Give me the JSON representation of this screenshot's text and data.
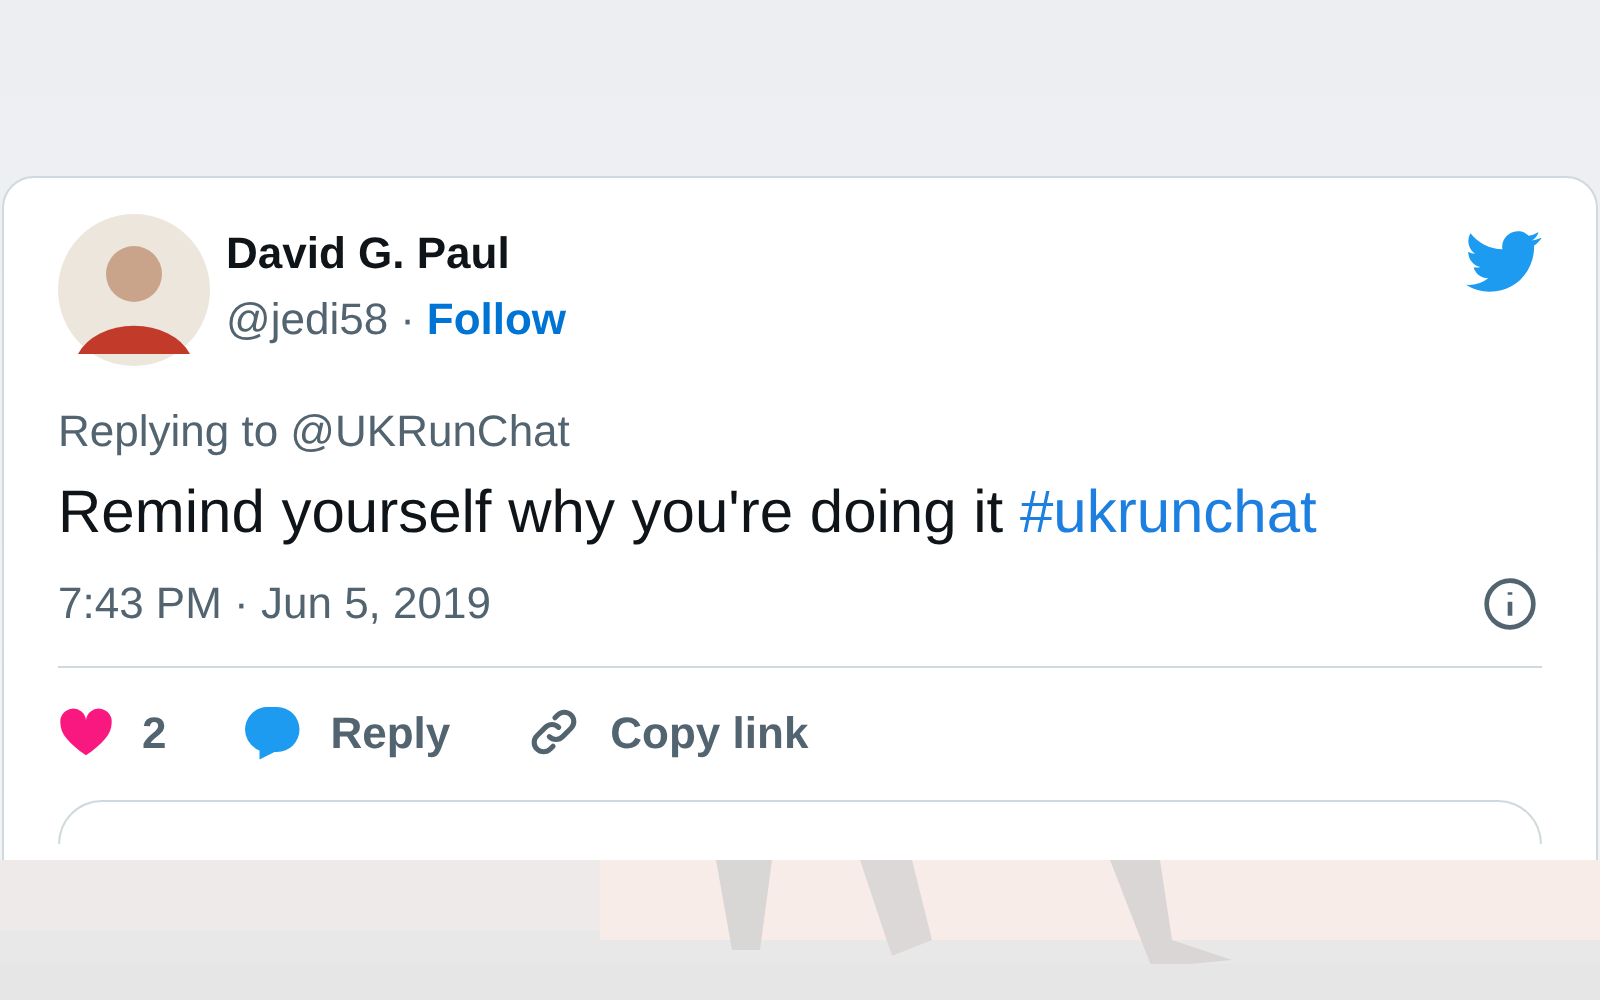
{
  "tweet": {
    "author": {
      "name": "David G. Paul",
      "handle": "@jedi58",
      "separator": "·",
      "follow": "Follow"
    },
    "replying_to": "Replying to @UKRunChat",
    "text": "Remind yourself why you're doing it ",
    "hashtag": "#ukrunchat",
    "timestamp": "7:43 PM · Jun 5, 2019",
    "actions": [
      {
        "kind": "like",
        "label": "2"
      },
      {
        "kind": "reply",
        "label": "Reply"
      },
      {
        "kind": "copy",
        "label": "Copy link"
      }
    ]
  }
}
